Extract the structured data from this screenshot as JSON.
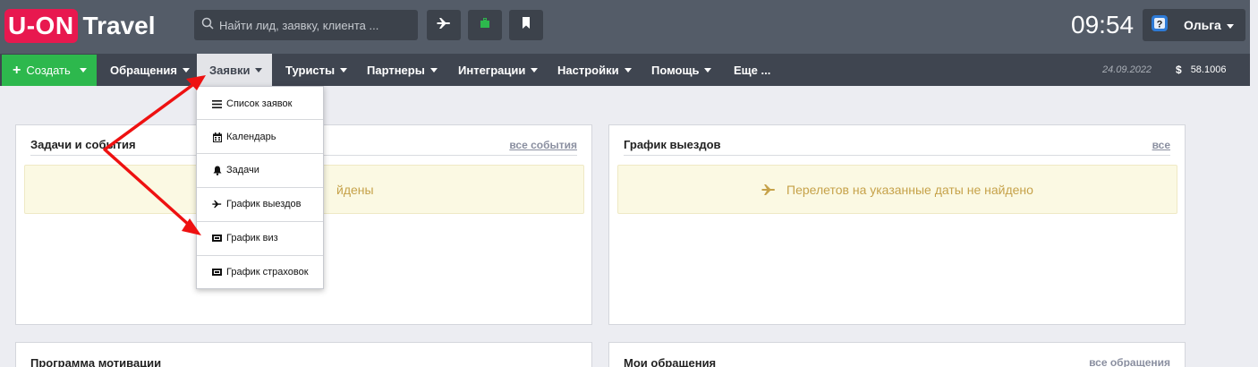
{
  "header": {
    "logo_brand": "U-ON",
    "logo_product": "Travel",
    "search_placeholder": "Найти лид, заявку, клиента ...",
    "time": "09:54",
    "user_name": "Ольга"
  },
  "nav": {
    "create_label": "Создать",
    "items": [
      "Обращения",
      "Заявки",
      "Туристы",
      "Партнеры",
      "Интеграции",
      "Настройки",
      "Помощь",
      "Еще ..."
    ],
    "active_item": "Заявки",
    "date": "24.09.2022",
    "currency_symbol": "$",
    "rate": "58.1006"
  },
  "dropdown": {
    "items": [
      {
        "label": "Список заявок",
        "icon": "list-icon"
      },
      {
        "label": "Календарь",
        "icon": "calendar-icon"
      },
      {
        "label": "Задачи",
        "icon": "bell-icon"
      },
      {
        "label": "График выездов",
        "icon": "plane-icon"
      },
      {
        "label": "График виз",
        "icon": "ticket-icon"
      },
      {
        "label": "График страховок",
        "icon": "ticket-icon"
      }
    ]
  },
  "panels": {
    "tasks": {
      "title": "Задачи и события",
      "link": "все события",
      "notice": "йдены"
    },
    "departures": {
      "title": "График выездов",
      "link": "все",
      "notice": "Перелетов на указанные даты не найдено"
    },
    "motivation": {
      "title": "Программа мотивации"
    },
    "my_requests": {
      "title": "Мои обращения",
      "link": "все обращения"
    }
  },
  "colors": {
    "brand": "#e8184f",
    "create_button": "#2db84d",
    "header_bg": "#545c68",
    "nav_bg": "#3f4550",
    "notice_text": "#c6a24a",
    "annotation_arrow": "#ee1111"
  }
}
